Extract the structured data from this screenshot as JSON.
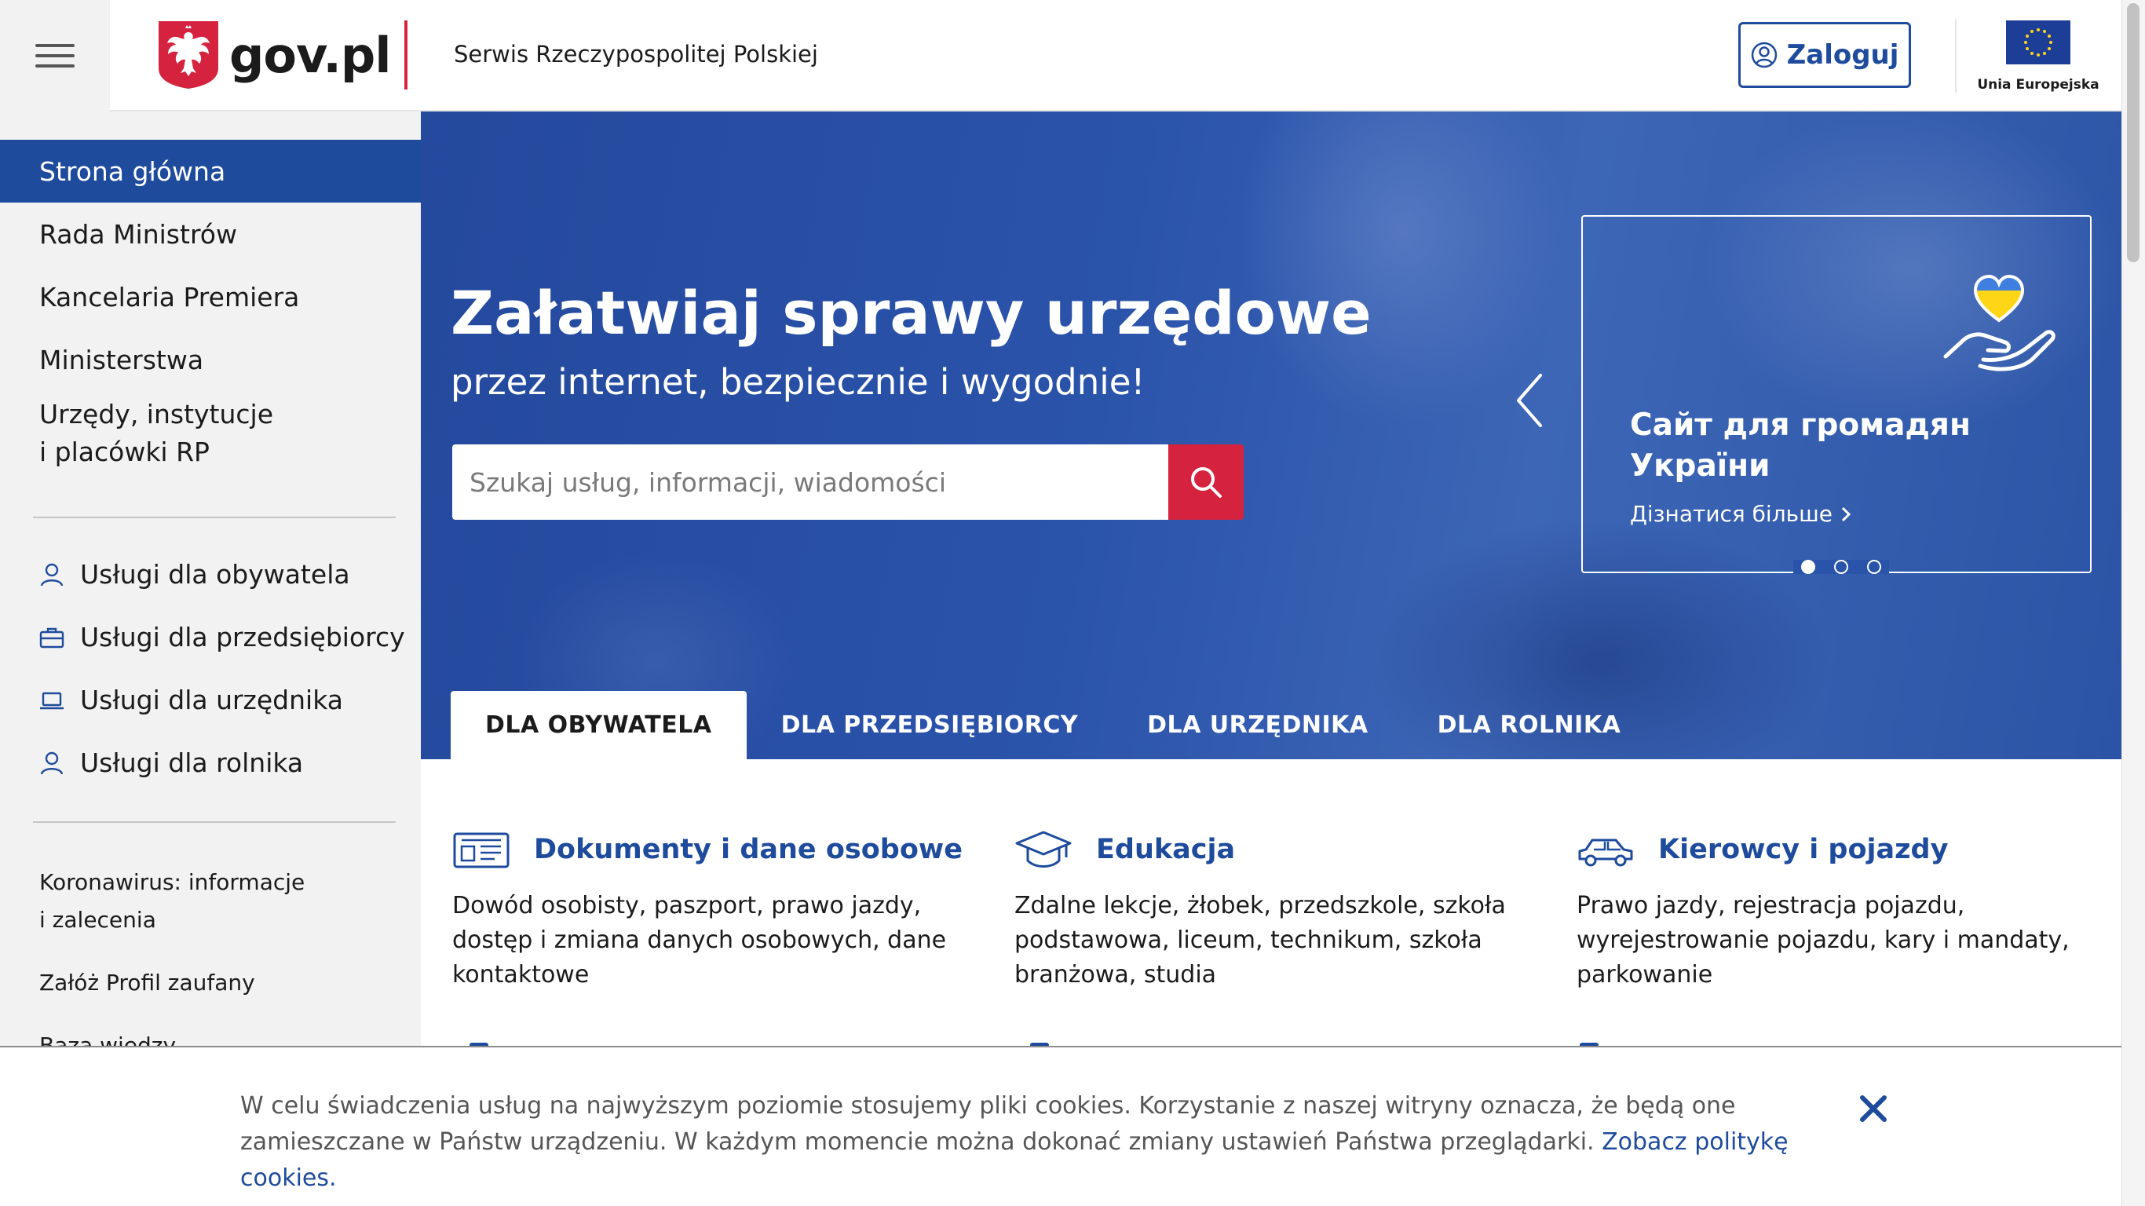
{
  "header": {
    "logo_text": "gov.pl",
    "serwis": "Serwis Rzeczypospolitej Polskiej",
    "login_label": "Zaloguj",
    "eu_label": "Unia Europejska"
  },
  "sidebar": {
    "nav": [
      {
        "label": "Strona główna",
        "active": true
      },
      {
        "label": "Rada Ministrów"
      },
      {
        "label": "Kancelaria Premiera"
      },
      {
        "label": "Ministerstwa"
      },
      {
        "label": "Urzędy, instytucje",
        "label2": "i placówki RP"
      }
    ],
    "services": [
      {
        "label": "Usługi dla obywatela",
        "icon": "person-icon"
      },
      {
        "label": "Usługi dla przedsiębiorcy",
        "icon": "briefcase-icon"
      },
      {
        "label": "Usługi dla urzędnika",
        "icon": "laptop-icon"
      },
      {
        "label": "Usługi dla rolnika",
        "icon": "person-icon"
      }
    ],
    "links": [
      {
        "label": "Koronawirus: informacje",
        "label2": "i zalecenia"
      },
      {
        "label": "Załóż Profil zaufany"
      },
      {
        "label": "Baza wiedzy"
      }
    ]
  },
  "hero": {
    "title": "Załatwiaj sprawy urzędowe",
    "subtitle": "przez internet, bezpiecznie i wygodnie!",
    "search_placeholder": "Szukaj usług, informacji, wiadomości",
    "promo_title": "Сайт для громадян України",
    "promo_link": "Дізнатися більше",
    "tabs": [
      "DLA OBYWATELA",
      "DLA PRZEDSIĘBIORCY",
      "DLA URZĘDNIKA",
      "DLA ROLNIKA"
    ]
  },
  "categories": [
    {
      "title": "Dokumenty i dane osobowe",
      "desc": "Dowód osobisty, paszport, prawo jazdy, dostęp i zmiana danych osobowych, dane kontaktowe",
      "icon": "id-card-icon"
    },
    {
      "title": "Edukacja",
      "desc": "Zdalne lekcje, żłobek, przedszkole, szkoła podstawowa, liceum, technikum, szkoła branżowa, studia",
      "icon": "graduation-cap-icon"
    },
    {
      "title": "Kierowcy i pojazdy",
      "desc": "Prawo jazdy, rejestracja pojazdu, wyrejestrowanie pojazdu, kary i mandaty, parkowanie",
      "icon": "car-icon"
    }
  ],
  "cookie": {
    "text": "W celu świadczenia usług na najwyższym poziomie stosujemy pliki cookies. Korzystanie z naszej witryny oznacza, że będą one zamieszczane w Państw urządzeniu. W każdym momencie można dokonać zmiany ustawień Państwa przeglądarki.",
    "link": "Zobacz politykę cookies."
  },
  "colors": {
    "primary": "#1e4b9c",
    "accent_red": "#d5233f",
    "sidebar_bg": "#f2f2f2"
  }
}
